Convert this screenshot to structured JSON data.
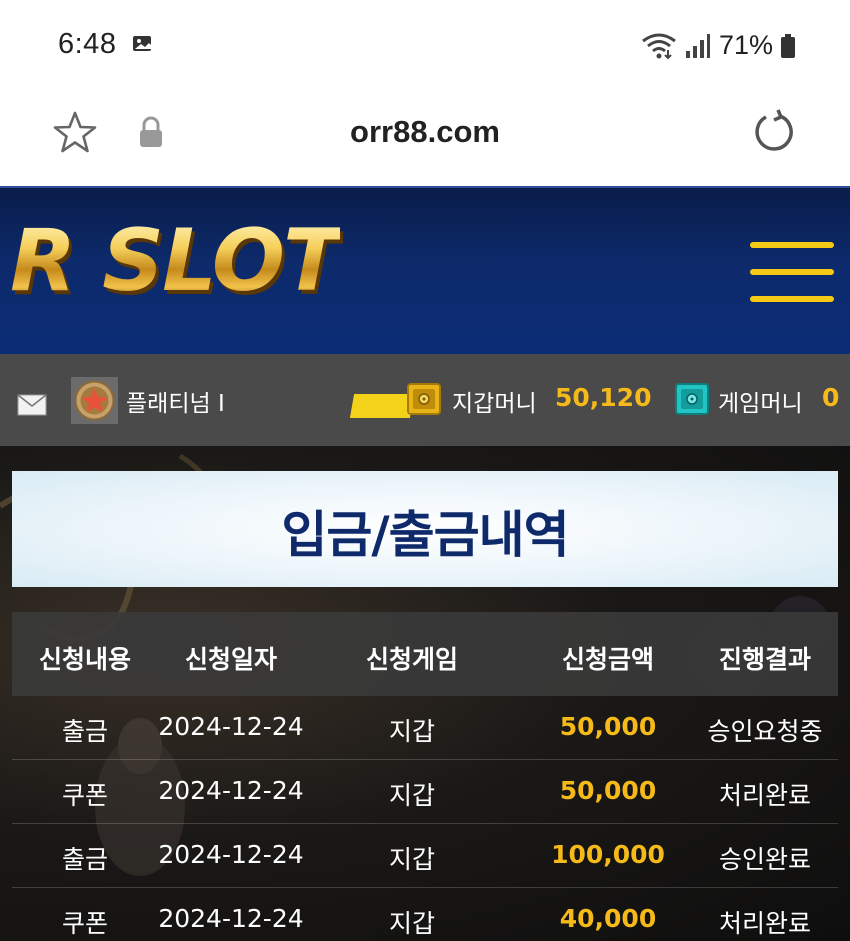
{
  "status_bar": {
    "time": "6:48",
    "battery": "71%"
  },
  "browser": {
    "url": "orr88.com"
  },
  "header": {
    "logo": "R SLOT"
  },
  "user_bar": {
    "rank": "플래티넘 I",
    "wallet_label": "지갑머니",
    "wallet_value": "50,120",
    "game_label": "게임머니",
    "game_value": "0"
  },
  "page": {
    "title": "입금/출금내역"
  },
  "table": {
    "headers": [
      "신청내용",
      "신청일자",
      "신청게임",
      "신청금액",
      "진행결과"
    ],
    "rows": [
      [
        "출금",
        "2024-12-24",
        "지갑",
        "50,000",
        "승인요청중"
      ],
      [
        "쿠폰",
        "2024-12-24",
        "지갑",
        "50,000",
        "처리완료"
      ],
      [
        "출금",
        "2024-12-24",
        "지갑",
        "100,000",
        "승인완료"
      ],
      [
        "쿠폰",
        "2024-12-24",
        "지갑",
        "40,000",
        "처리완료"
      ]
    ]
  },
  "colors": {
    "header_bg": "#0d2a6b",
    "accent_gold": "#f6b91a",
    "menu_yellow": "#f5c916",
    "title_navy": "#0f2a6b",
    "info_bar_bg": "#4a4a4a"
  }
}
